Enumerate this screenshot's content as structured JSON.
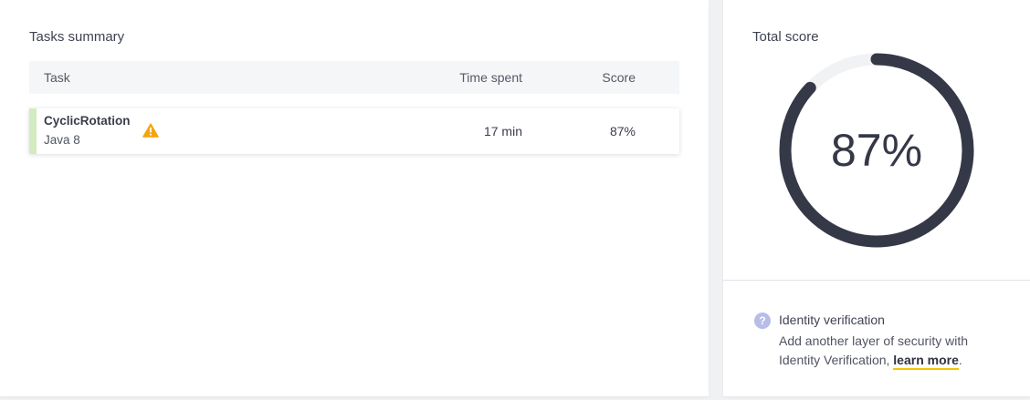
{
  "tasks_summary": {
    "title": "Tasks summary",
    "columns": {
      "task": "Task",
      "time": "Time spent",
      "score": "Score"
    },
    "rows": [
      {
        "name": "CyclicRotation",
        "language": "Java 8",
        "time": "17 min",
        "score": "87%",
        "icon": "warning-icon",
        "accent_color": "#d3ecbf"
      }
    ]
  },
  "total_score": {
    "title": "Total score",
    "value_text": "87%",
    "value": 87,
    "ring_color": "#353847",
    "track_color": "#f1f2f4"
  },
  "identity": {
    "icon": "help-icon",
    "title": "Identity verification",
    "desc_prefix": "Add another layer of security with Identity Verification, ",
    "link_text": "learn more",
    "desc_suffix": ".",
    "link_underline_color": "#f5c400"
  }
}
